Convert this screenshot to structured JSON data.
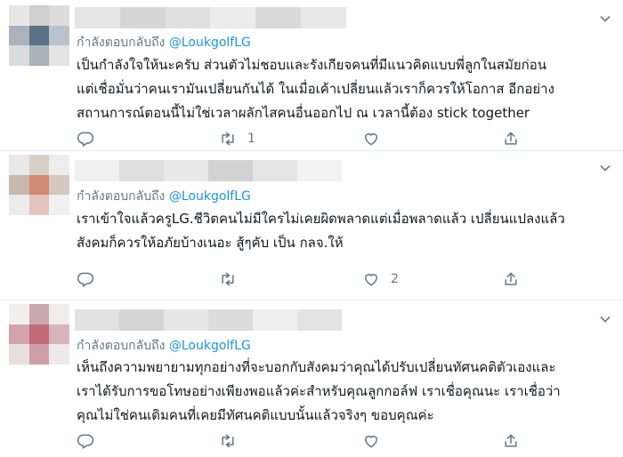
{
  "replying_prefix": "กำลังตอบกลับถึง",
  "tweets": [
    {
      "mention": "@LoukgolfLG",
      "lines": [
        "เป็นกำลังใจให้นะครับ ส่วนตัวไม่ชอบและรังเกียจคนที่มีแนวคิดแบบพี่ลูกในสมัยก่อน",
        "แต่เชื่อมั่นว่าคนเรามันเปลี่ยนกันได้ ในเมื่อเค้าเปลี่ยนแล้วเราก็ควรให้โอกาส  อีกอย่าง",
        "สถานการณ์ตอนนี้ไม่ใช่เวลาผลักไสคนอื่นออกไป ณ เวลานี้ต้อง stick together"
      ],
      "retweet_count": "1",
      "like_count": "",
      "avatar_colors": [
        "#e6e6e6",
        "#cfcfcf",
        "#dcdcdc",
        "#aab3bc",
        "#5a7286",
        "#b9c3cc",
        "#d9dcdf",
        "#a9b2b8",
        "#e3e3e3"
      ],
      "name_colors": [
        "#e4e4e4",
        "#d6d6d6",
        "#e0e0e0",
        "#ececec",
        "#dadada",
        "#e8e8e8"
      ]
    },
    {
      "mention": "@LoukgolfLG",
      "lines": [
        "เราเข้าใจแล้วครูLG.ชีวิตคนไม่มีใครไม่เคยผิดพลาดแต่เมื่อพลาดแล้ว เปลี่ยนแปลงแล้ว",
        "สังคมก็ควรให้อภัยบ้างเนอะ สู้ๆคับ เป็น กลจ.ให้"
      ],
      "retweet_count": "",
      "like_count": "2",
      "avatar_colors": [
        "#e8e8e8",
        "#d8cfc8",
        "#ededed",
        "#c8b8ac",
        "#d28a74",
        "#d4c8bf",
        "#ececec",
        "#e2c5bd",
        "#f0f0f0"
      ],
      "name_colors": [
        "#f0f0f0",
        "#dedede",
        "#e9e9e9",
        "#d2d2d2",
        "#e6e6e6",
        "#f2f2f2"
      ]
    },
    {
      "mention": "@LoukgolfLG",
      "lines": [
        "เห็นถึงความพยายามทุกอย่างที่จะบอกกับสังคมว่าคุณได้ปรับเปลี่ยนทัศนคติตัวเองและ",
        "เราได้รับการขอโทษอย่างเพียงพอแล้วค่ะสำหรับคุณลูกกอล์ฟ เราเชื่อคุณนะ เราเชื่อว่า",
        "คุณไม่ใช่คนเดิมคนที่เคยมีทัศนคติแบบนั้นแล้วจริงๆ ขอบคุณค่ะ"
      ],
      "retweet_count": "",
      "like_count": "",
      "avatar_colors": [
        "#f1eeee",
        "#c8a9ad",
        "#efecec",
        "#d3a4ac",
        "#c26a7a",
        "#d8b3b9",
        "#e9dfe0",
        "#cf9ea7",
        "#eeeaea"
      ],
      "name_colors": [
        "#e2e2e2",
        "#d4d4d4",
        "#e6e6e6",
        "#dcdcdc",
        "#efefef",
        "#e3e3e3"
      ]
    }
  ],
  "icons": {
    "reply": "reply-icon",
    "retweet": "retweet-icon",
    "like": "heart-icon",
    "share": "share-icon",
    "more": "chevron-down-icon"
  },
  "colors": {
    "mention": "#1b95e0",
    "muted": "#657786",
    "text": "#14171a",
    "divider": "#e6ecf0"
  }
}
